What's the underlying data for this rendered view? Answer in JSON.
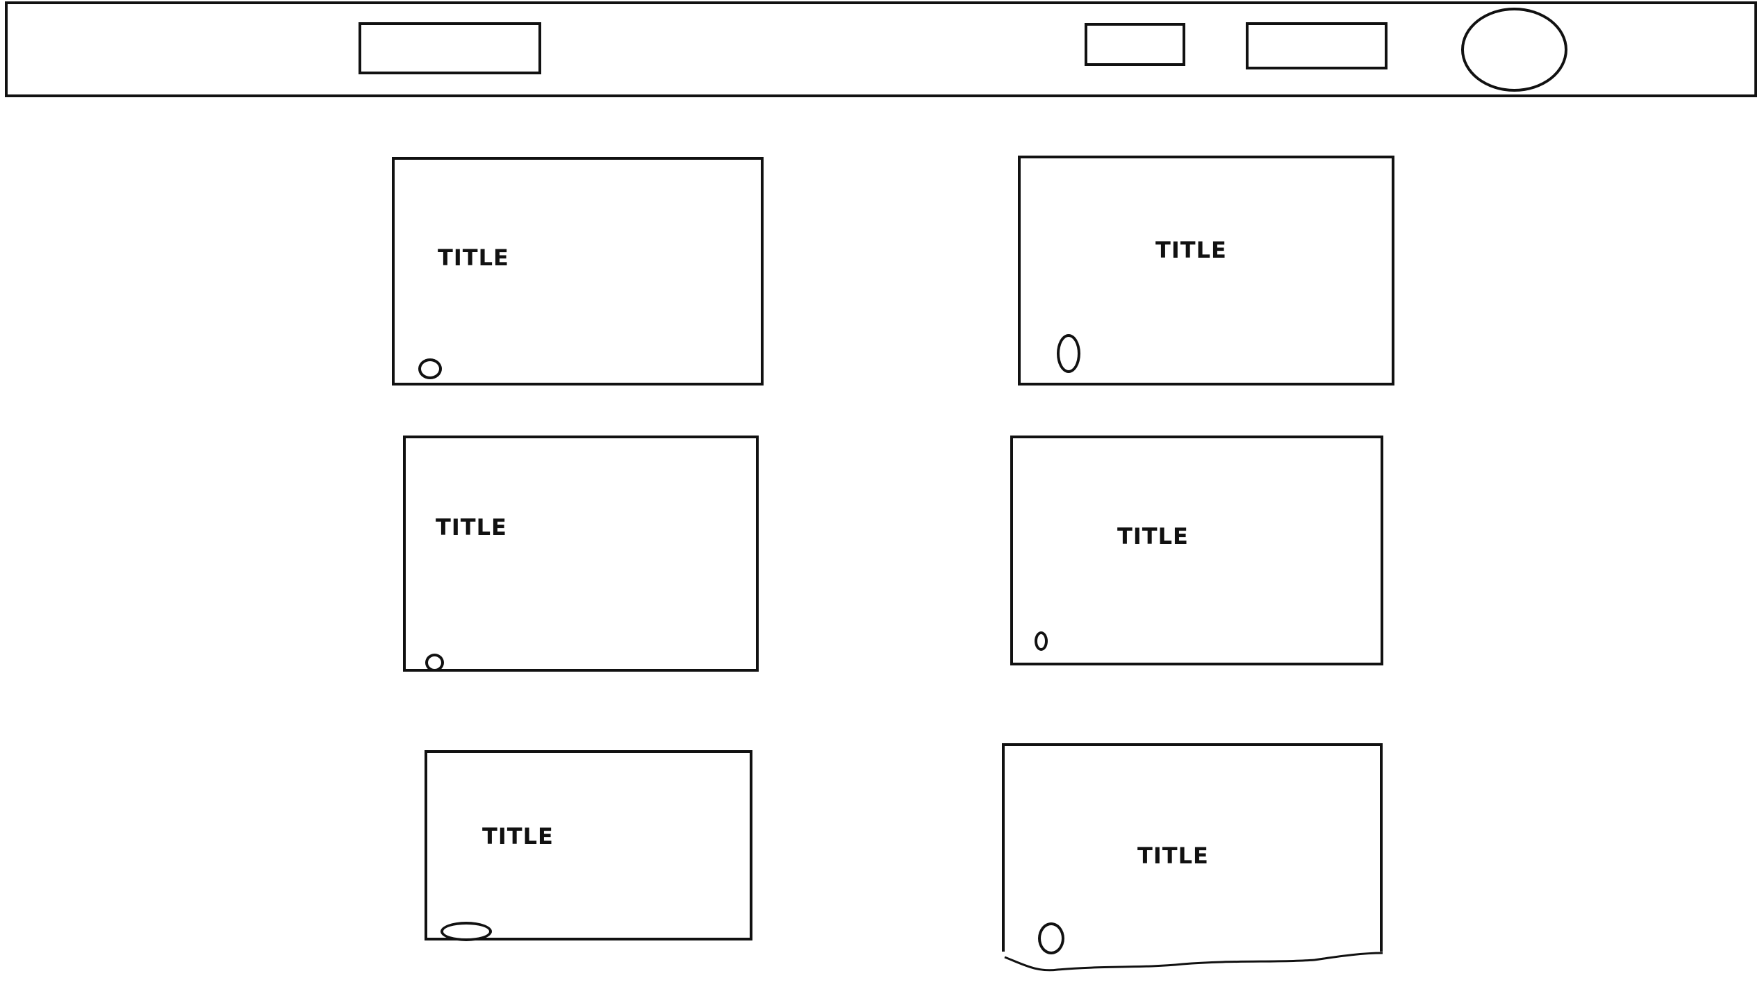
{
  "cards": [
    {
      "title": "TITLE"
    },
    {
      "title": "TITLE"
    },
    {
      "title": "TITLE"
    },
    {
      "title": "TITLE"
    },
    {
      "title": "TITLE"
    },
    {
      "title": "TITLE"
    }
  ],
  "colors": {
    "stroke": "#111111",
    "background": "#ffffff"
  }
}
